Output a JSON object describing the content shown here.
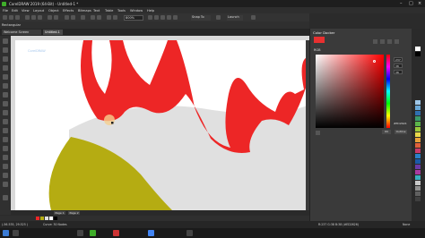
{
  "window": {
    "title": "CorelDRAW 2019 (64-Bit) - Untitled-1 *"
  },
  "menu": [
    "File",
    "Edit",
    "View",
    "Layout",
    "Object",
    "Effects",
    "Bitmaps",
    "Text",
    "Table",
    "Tools",
    "Window",
    "Help"
  ],
  "toolbar": {
    "zoom": "800%",
    "snap_label": "Snap To",
    "launch_label": "Launch"
  },
  "propbar": {
    "label": "Rectangular"
  },
  "tabs": [
    {
      "label": "Welcome Screen"
    },
    {
      "label": "Untitled-1"
    }
  ],
  "pages": [
    "Page 1",
    "Page 2"
  ],
  "status": {
    "left": "(-56.535, 29.525 )",
    "center": "Curve: 30 Nodes",
    "fill_info": "R:237 G:38 B:38 (#ED2626)",
    "right_label": "None"
  },
  "docker": {
    "title": "Color Docker",
    "model": "RGB",
    "values": {
      "r": "237",
      "g": "38",
      "b": "38"
    },
    "hex": "#ED2626",
    "ok": "OK",
    "outline": "Outline"
  },
  "colors": {
    "red_shape": "#ED2626",
    "olive": "#B5AC12",
    "gray": "#E0E0E0",
    "accent": "#3FAE2A"
  },
  "watermark": "CorelDRAW"
}
